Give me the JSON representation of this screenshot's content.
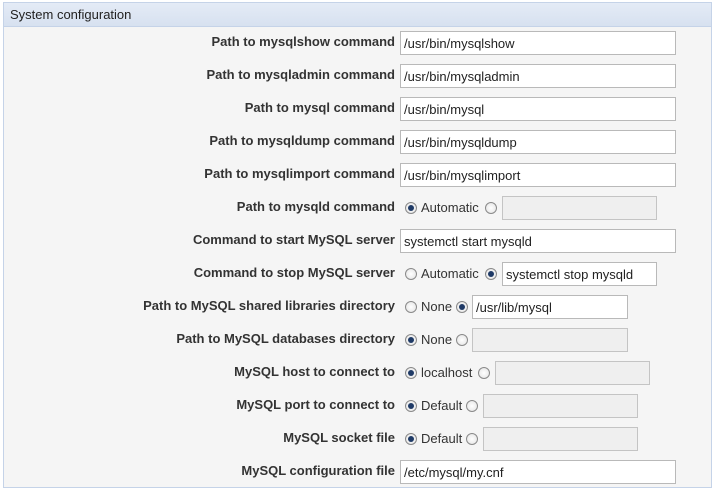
{
  "section": {
    "title": "System configuration"
  },
  "fields": {
    "mysqlshow": {
      "label": "Path to mysqlshow command",
      "value": "/usr/bin/mysqlshow"
    },
    "mysqladmin": {
      "label": "Path to mysqladmin command",
      "value": "/usr/bin/mysqladmin"
    },
    "mysql": {
      "label": "Path to mysql command",
      "value": "/usr/bin/mysql"
    },
    "mysqldump": {
      "label": "Path to mysqldump command",
      "value": "/usr/bin/mysqldump"
    },
    "mysqlimport": {
      "label": "Path to mysqlimport command",
      "value": "/usr/bin/mysqlimport"
    },
    "mysqld": {
      "label": "Path to mysqld command",
      "option_label": "Automatic",
      "selected": "Automatic",
      "value": ""
    },
    "start_cmd": {
      "label": "Command to start MySQL server",
      "value": "systemctl start mysqld"
    },
    "stop_cmd": {
      "label": "Command to stop MySQL server",
      "option_label": "Automatic",
      "selected": "custom",
      "value": "systemctl stop mysqld"
    },
    "shared_libs": {
      "label": "Path to MySQL shared libraries directory",
      "option_label": "None",
      "selected": "custom",
      "value": "/usr/lib/mysql"
    },
    "databases_dir": {
      "label": "Path to MySQL databases directory",
      "option_label": "None",
      "selected": "None",
      "value": ""
    },
    "host": {
      "label": "MySQL host to connect to",
      "option_label": "localhost",
      "selected": "localhost",
      "value": ""
    },
    "port": {
      "label": "MySQL port to connect to",
      "option_label": "Default",
      "selected": "Default",
      "value": ""
    },
    "socket": {
      "label": "MySQL socket file",
      "option_label": "Default",
      "selected": "Default",
      "value": ""
    },
    "config_file": {
      "label": "MySQL configuration file",
      "value": "/etc/mysql/my.cnf"
    }
  }
}
